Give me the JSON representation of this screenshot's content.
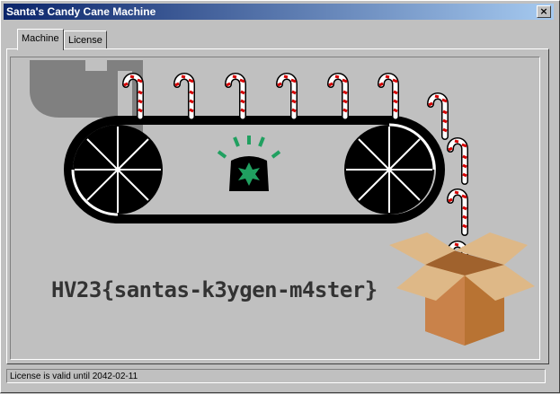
{
  "window": {
    "title": "Santa's Candy Cane Machine",
    "close_glyph": "×"
  },
  "tabs": [
    {
      "label": "Machine",
      "active": true
    },
    {
      "label": "License",
      "active": false
    }
  ],
  "machine": {
    "flag_text": "HV23{santas-k3ygen-m4ster}"
  },
  "status_bar": {
    "text": "License is valid until 2042-02-11"
  },
  "icons": {
    "hopper": "hopper-icon",
    "wheel": "wheel-icon",
    "beacon": "beacon-light-icon",
    "candy": "candy-cane-icon",
    "box": "open-box-icon"
  },
  "colors": {
    "title_start": "#0a246a",
    "title_end": "#a6caf0",
    "box": "#b87333",
    "box_light": "#deb887",
    "beacon": "#20a060",
    "cane_red": "#d60000"
  }
}
